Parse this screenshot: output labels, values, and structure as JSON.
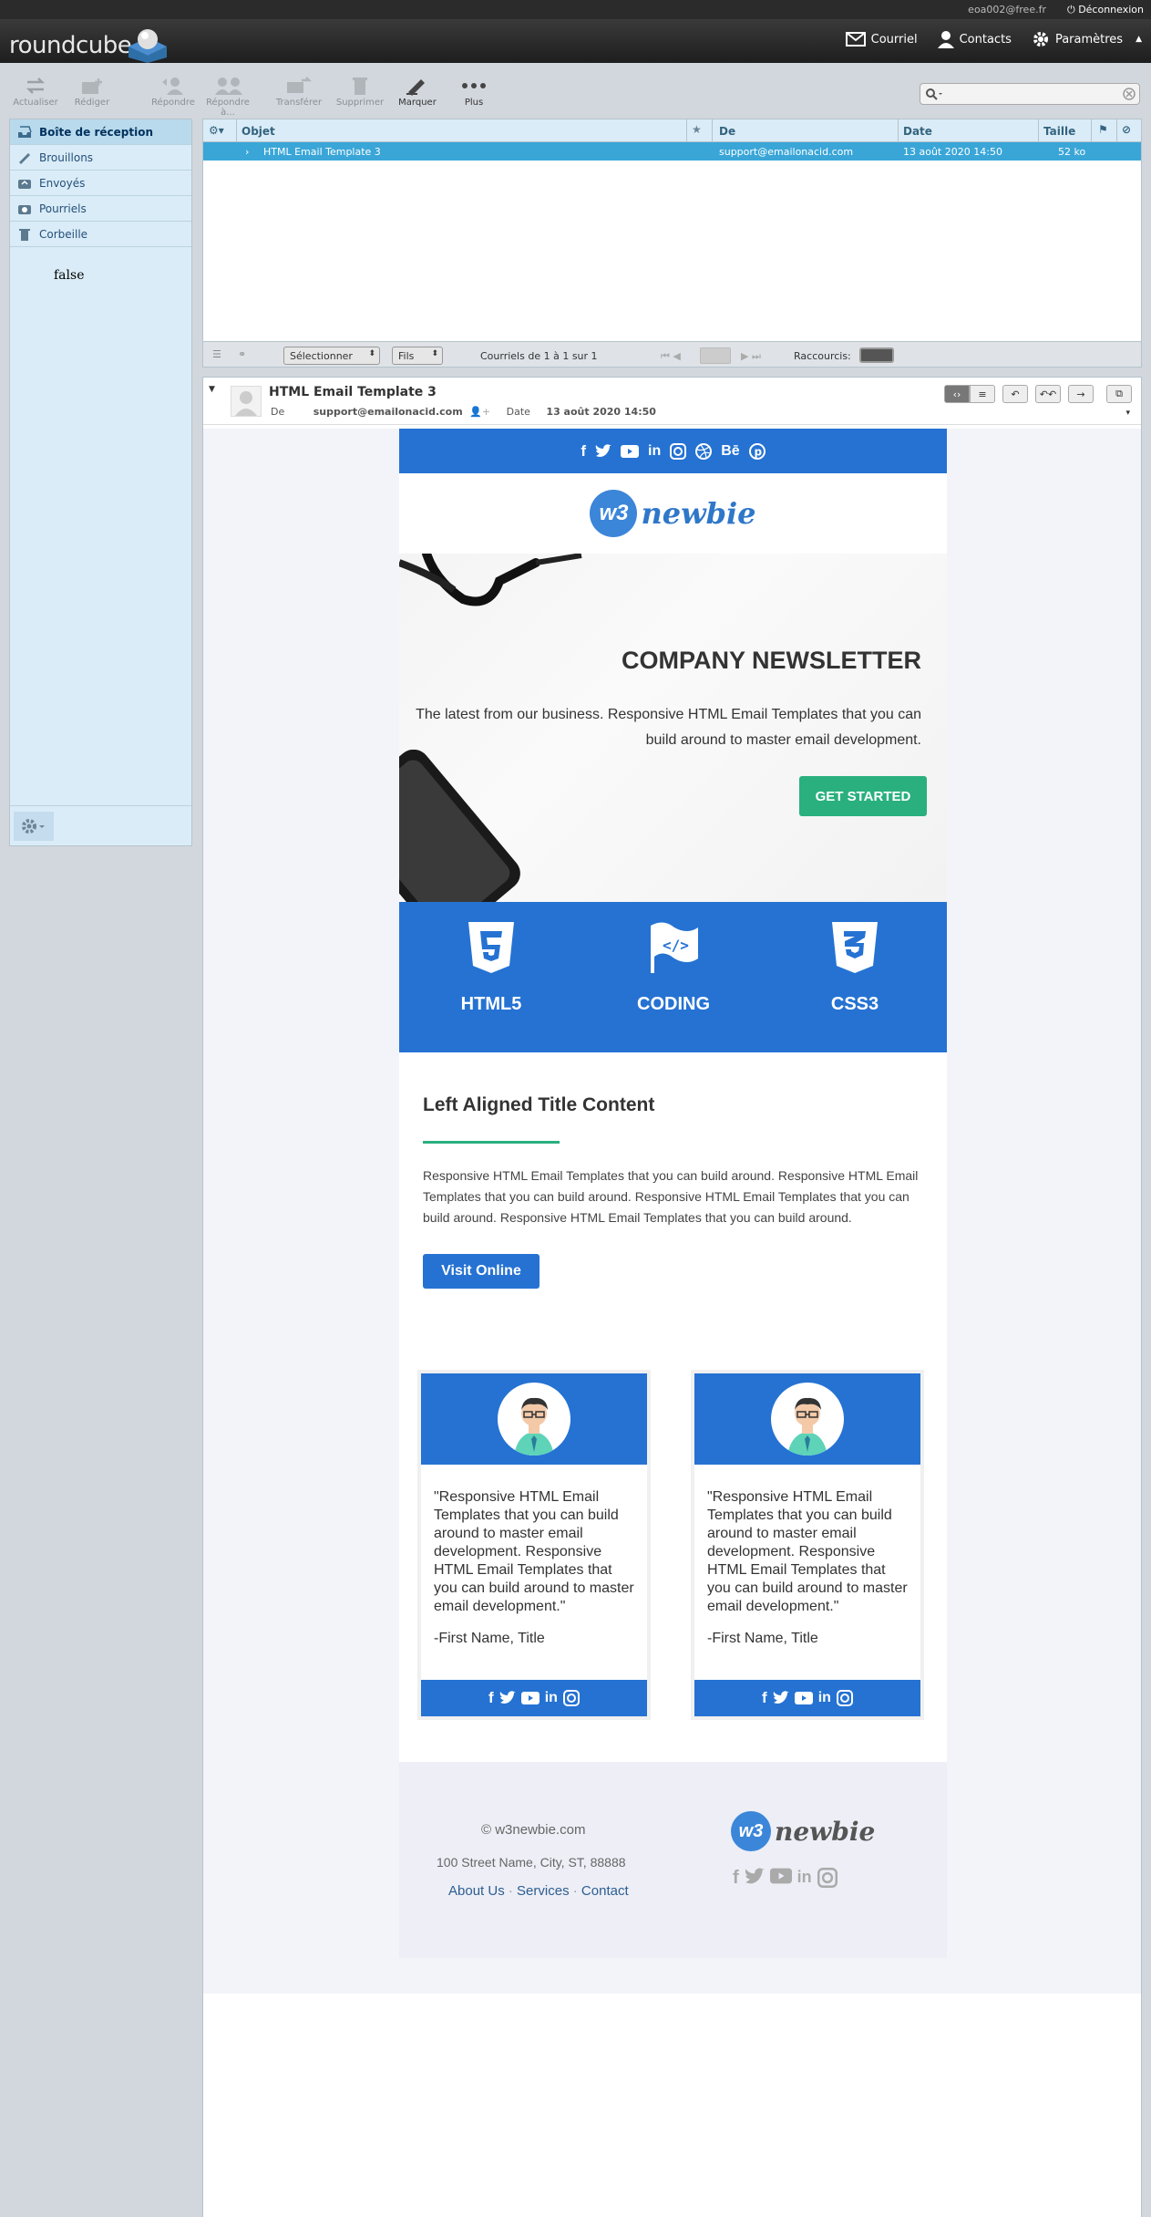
{
  "top": {
    "user": "eoa002@free.fr",
    "logout": "Déconnexion"
  },
  "app": {
    "logo": "roundcube",
    "nav": [
      "Courriel",
      "Contacts",
      "Paramètres"
    ]
  },
  "toolbar": {
    "refresh": "Actualiser",
    "compose": "Rédiger",
    "reply": "Répondre",
    "reply_all": "Répondre à...",
    "forward": "Transférer",
    "delete": "Supprimer",
    "mark": "Marquer",
    "more": "Plus"
  },
  "folders": [
    {
      "label": "Boîte de réception",
      "selected": true
    },
    {
      "label": "Brouillons"
    },
    {
      "label": "Envoyés"
    },
    {
      "label": "Pourriels"
    },
    {
      "label": "Corbeille"
    }
  ],
  "left_extra": "false",
  "list": {
    "headers": {
      "subject": "Objet",
      "from": "De",
      "date": "Date",
      "size": "Taille"
    },
    "rows": [
      {
        "subject": "HTML Email Template 3",
        "from": "support@emailonacid.com",
        "date": "13 août 2020 14:50",
        "size": "52 ko"
      }
    ],
    "footer": {
      "select": "Sélectionner",
      "threads": "Fils",
      "count": "Courriels de 1 à 1 sur 1",
      "shortcuts": "Raccourcis:"
    }
  },
  "preview": {
    "subject": "HTML Email Template 3",
    "from_label": "De",
    "from": "support@emailonacid.com",
    "date_label": "Date",
    "date": "13 août 2020 14:50"
  },
  "email": {
    "brand": {
      "mark": "w3",
      "name": "newbie"
    },
    "hero": {
      "title": "COMPANY NEWSLETTER",
      "text": "The latest from our business. Responsive HTML Email Templates that you can build around to master email development.",
      "button": "GET STARTED"
    },
    "features": [
      "HTML5",
      "CODING",
      "CSS3"
    ],
    "section": {
      "title": "Left Aligned Title Content",
      "text": "Responsive HTML Email Templates that you can build around. Responsive HTML Email Templates that you can build around. Responsive HTML Email Templates that you can build around. Responsive HTML Email Templates that you can build around.",
      "button": "Visit Online"
    },
    "testimonials": [
      {
        "quote": "\"Responsive HTML Email Templates that you can build around to master email development. Responsive HTML Email Templates that you can build around to master email development.\"",
        "signature": "-First Name, Title"
      },
      {
        "quote": "\"Responsive HTML Email Templates that you can build around to master email development. Responsive HTML Email Templates that you can build around to master email development.\"",
        "signature": "-First Name, Title"
      }
    ],
    "footer": {
      "copyright": "© w3newbie.com",
      "address": "100 Street Name, City, ST, 88888",
      "links": [
        "About Us",
        "Services",
        "Contact"
      ]
    }
  },
  "colors": {
    "email_blue": "#2572d3",
    "green": "#29b07e",
    "list_selected": "#3aa6d8"
  }
}
